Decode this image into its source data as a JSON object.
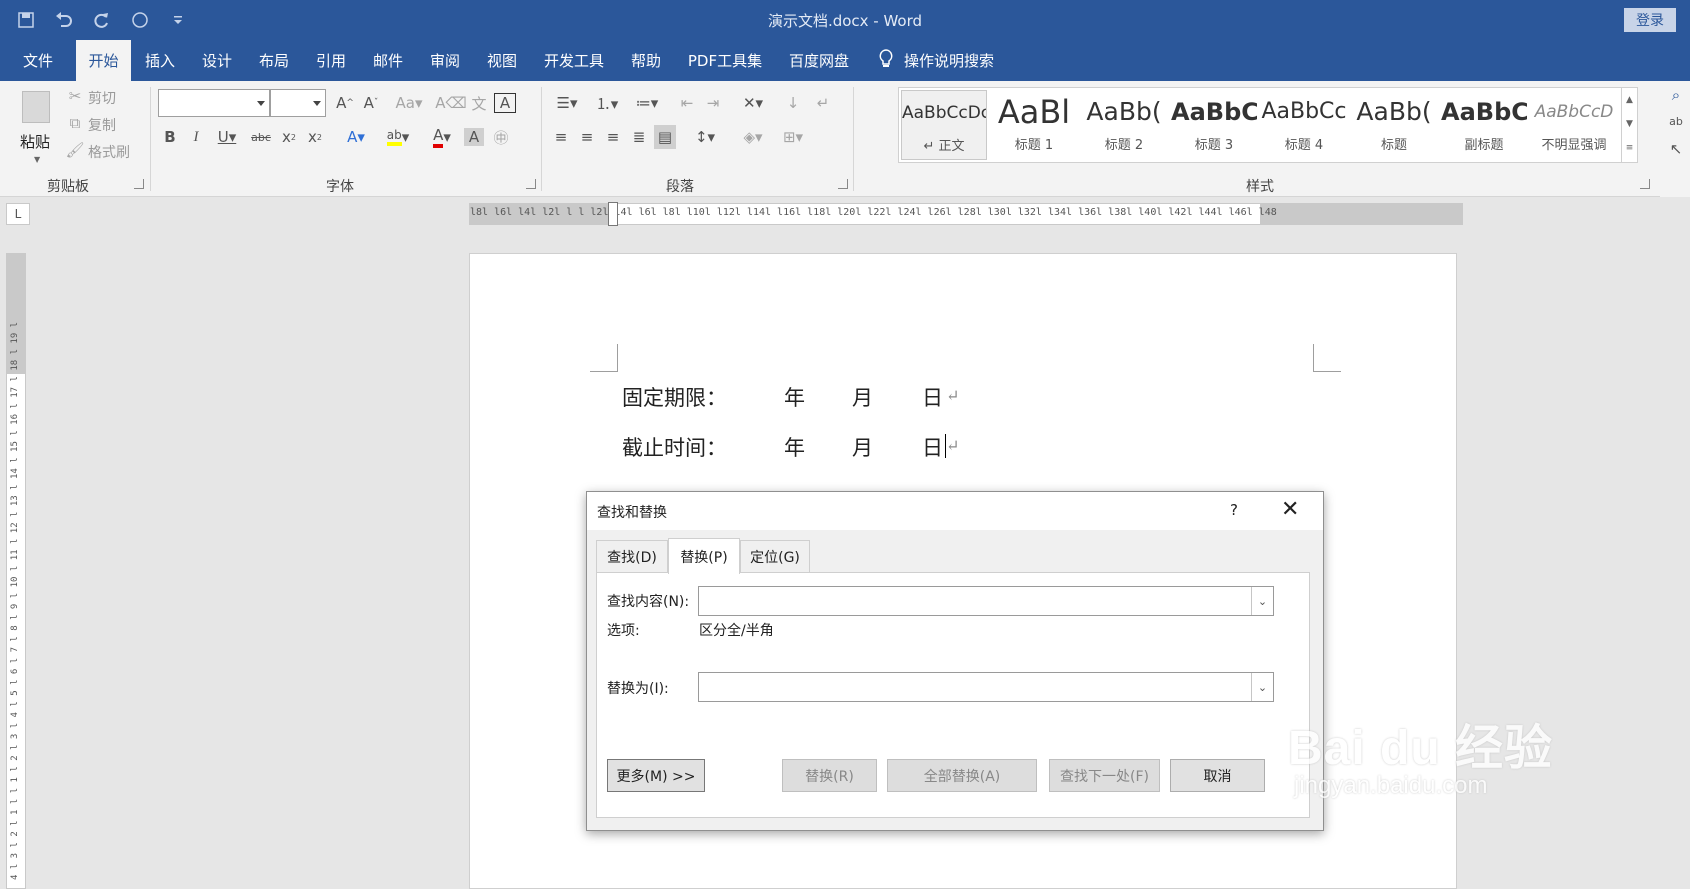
{
  "window": {
    "title": "演示文档.docx  -  Word",
    "login": "登录"
  },
  "quick_access": [
    "save-icon",
    "undo-icon",
    "redo-icon",
    "circle-icon",
    "customize-icon"
  ],
  "tabs": [
    "文件",
    "开始",
    "插入",
    "设计",
    "布局",
    "引用",
    "邮件",
    "审阅",
    "视图",
    "开发工具",
    "帮助",
    "PDF工具集",
    "百度网盘"
  ],
  "tell_me": "操作说明搜索",
  "ribbon": {
    "clipboard": {
      "paste": "粘贴",
      "cut": "剪切",
      "copy": "复制",
      "format_painter": "格式刷",
      "label": "剪贴板"
    },
    "font": {
      "label": "字体"
    },
    "paragraph": {
      "label": "段落"
    },
    "styles": {
      "label": "样式",
      "items": [
        {
          "preview": "AaBbCcDc",
          "name": "↵ 正文"
        },
        {
          "preview": "AaBl",
          "name": "标题 1"
        },
        {
          "preview": "AaBb(",
          "name": "标题 2"
        },
        {
          "preview": "AaBbC",
          "name": "标题 3"
        },
        {
          "preview": "AaBbCc",
          "name": "标题 4"
        },
        {
          "preview": "AaBb(",
          "name": "标题"
        },
        {
          "preview": "AaBbC",
          "name": "副标题"
        },
        {
          "preview": "AaBbCcD",
          "name": "不明显强调"
        }
      ]
    }
  },
  "ruler": {
    "horizontal": "l8l l6l l4l l2l l l l2l l4l l6l l8l l10l l12l l14l l16l l18l l20l l22l l24l l26l l28l l30l l32l l34l l36l l38l l40l l42l l44l l46l l48",
    "vertical": "4 l 3 l 2 l 1 l l 1 l 2 l 3 l 4 l 5 l 6 l 7 l 8 l 9 l 10 l 11 l 12 l 13 l 14 l 15 l 16 l 17 l 18 l 19 l",
    "corner": "L"
  },
  "document": {
    "line1": {
      "label": "固定期限：",
      "year": "年",
      "month": "月",
      "day": "日",
      "mark": "↵"
    },
    "line2": {
      "label": "截止时间：",
      "year": "年",
      "month": "月",
      "day": "日",
      "mark": "↵"
    }
  },
  "dialog": {
    "title": "查找和替换",
    "help": "?",
    "close": "✕",
    "tabs": [
      "查找(D)",
      "替换(P)",
      "定位(G)"
    ],
    "find_label": "查找内容(N):",
    "find_value": "",
    "options_label": "选项:",
    "options_value": "区分全/半角",
    "replace_label": "替换为(I):",
    "replace_value": "",
    "buttons": {
      "more": "更多(M) >>",
      "replace": "替换(R)",
      "replace_all": "全部替换(A)",
      "find_next": "查找下一处(F)",
      "cancel": "取消"
    }
  },
  "watermark": {
    "main": "Bai du 经验",
    "sub": "jingyan.baidu.com"
  },
  "colors": {
    "brand": "#2b579a",
    "highlight": "#ffff00",
    "font_color": "#e00000"
  }
}
